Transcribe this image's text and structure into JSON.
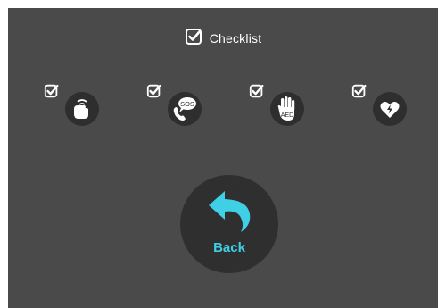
{
  "header": {
    "title": "Checklist",
    "icon": "checkbox-checked-icon"
  },
  "steps": [
    {
      "icon": "hand-tap-shoulder-icon",
      "checked": true
    },
    {
      "icon": "phone-sos-icon",
      "label": "SOS",
      "checked": true
    },
    {
      "icon": "hand-aed-icon",
      "label": "AED",
      "checked": true
    },
    {
      "icon": "heart-lightning-icon",
      "checked": true
    }
  ],
  "back": {
    "label": "Back",
    "icon": "back-arrow-icon"
  },
  "colors": {
    "background": "#4a4a4a",
    "circle": "#2e2e2e",
    "accent": "#3fd0e6",
    "text": "#ffffff"
  }
}
